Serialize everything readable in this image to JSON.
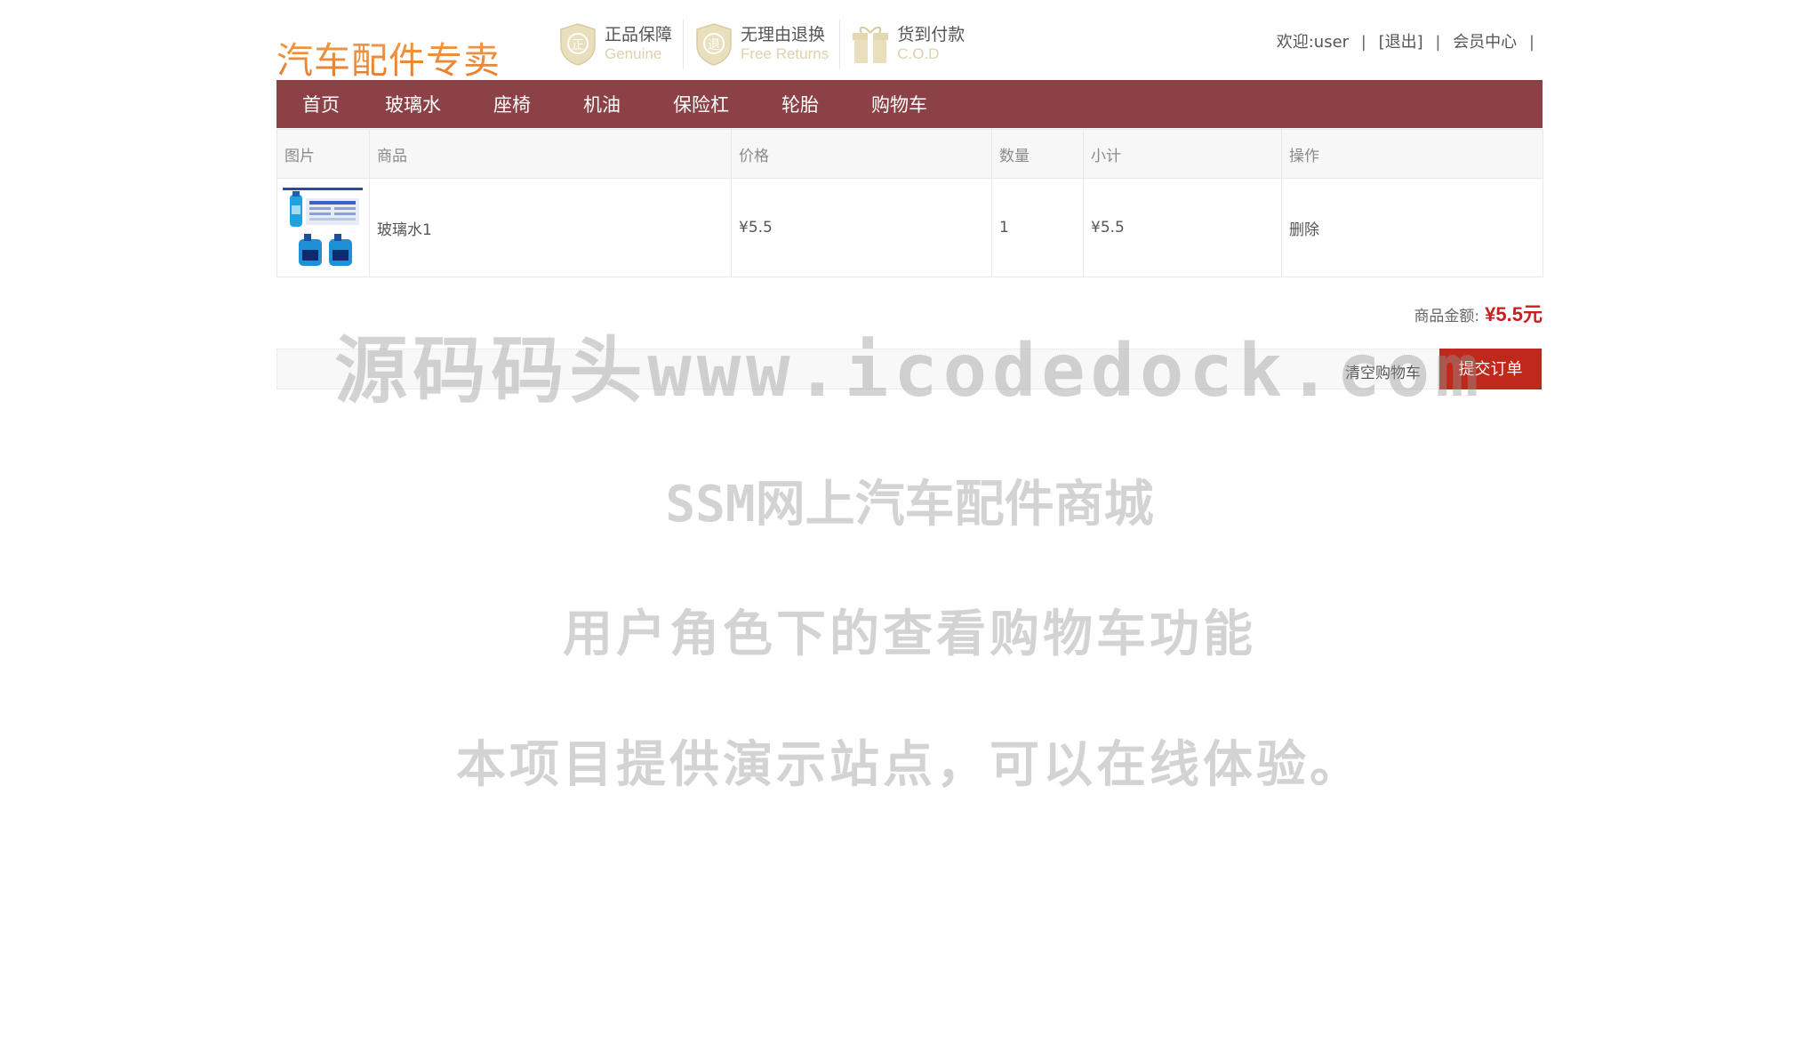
{
  "header": {
    "logo_text": "汽车配件专卖",
    "badges": [
      {
        "icon": "genuine-shield-icon",
        "glyph": "正",
        "title": "正品保障",
        "subtitle": "Genuine"
      },
      {
        "icon": "returns-shield-icon",
        "glyph": "退",
        "title": "无理由退换",
        "subtitle": "Free Returns"
      },
      {
        "icon": "gift-icon",
        "glyph": "",
        "title": "货到付款",
        "subtitle": "C.O.D"
      }
    ],
    "userbar": {
      "welcome": "欢迎:user",
      "logout": "[退出]",
      "member_center": "会员中心",
      "sep": "|"
    }
  },
  "nav": {
    "items": [
      "首页",
      "玻璃水",
      "座椅",
      "机油",
      "保险杠",
      "轮胎",
      "购物车"
    ]
  },
  "cart": {
    "columns": [
      "图片",
      "商品",
      "价格",
      "数量",
      "小计",
      "操作"
    ],
    "rows": [
      {
        "product": "玻璃水1",
        "price": "¥5.5",
        "quantity": "1",
        "subtotal": "¥5.5",
        "action": "删除"
      }
    ],
    "total_label": "商品金额:",
    "total_value": "¥5.5元",
    "clear_label": "清空购物车",
    "submit_label": "提交订单"
  },
  "watermark": {
    "line1": "源码码头www.icodedock.com",
    "line2": "SSM网上汽车配件商城",
    "line3": "用户角色下的查看购物车功能",
    "line4": "本项目提供演示站点，可以在线体验。"
  },
  "colors": {
    "nav_bg": "#8b4145",
    "logo": "#e8863a",
    "submit_bg": "#c0281b",
    "total_price": "#c81f1f",
    "badge_icon": "#e4d9b4"
  }
}
